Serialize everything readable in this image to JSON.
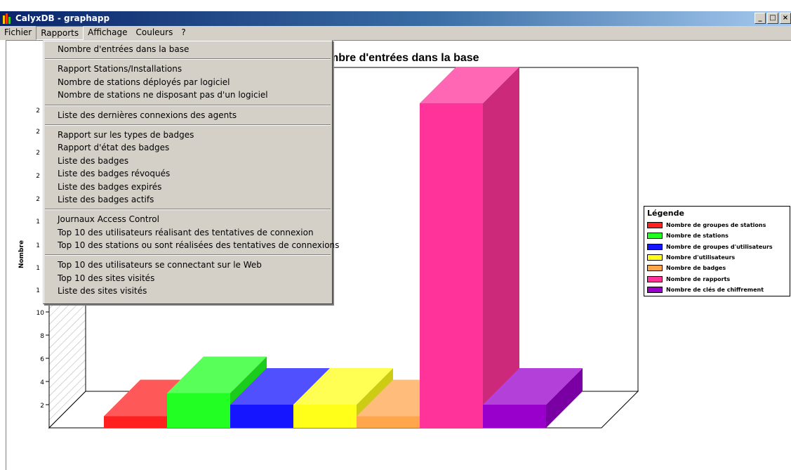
{
  "window": {
    "title": "CalyxDB - graphapp",
    "controls": [
      "_",
      "□",
      "×"
    ]
  },
  "menubar": {
    "items": [
      "Fichier",
      "Rapports",
      "Affichage",
      "Couleurs",
      "?"
    ],
    "active": "Rapports"
  },
  "dropdown": {
    "groups": [
      [
        "Nombre d'entrées dans la base"
      ],
      [
        "Rapport Stations/Installations",
        "Nombre de stations déployés par logiciel",
        "Nombre de stations ne disposant pas d'un logiciel"
      ],
      [
        "Liste des dernières connexions des agents"
      ],
      [
        "Rapport sur les types de badges",
        "Rapport d'état des badges",
        "Liste des badges",
        "Liste des badges révoqués",
        "Liste des badges expirés",
        "Liste des badges actifs"
      ],
      [
        "Journaux Access Control",
        "Top 10 des utilisateurs réalisant des tentatives de connexion",
        "Top 10 des stations ou sont réalisées des tentatives de connexions"
      ],
      [
        "Top 10 des utilisateurs se connectant sur le Web",
        "Top 10 des sites visités",
        "Liste des sites visités"
      ]
    ]
  },
  "chart_data": {
    "type": "bar",
    "title": "Nombre d'entrées dans la base",
    "ylabel": "Nombre",
    "visible_title_fragment": "mbre d'entrées dans la base",
    "y_ticks": [
      2,
      4,
      6,
      8,
      10
    ],
    "ylim": [
      0,
      30
    ],
    "series": [
      {
        "name": "Nombre de groupes de stations",
        "value": 1,
        "color": "#ff2020"
      },
      {
        "name": "Nombre de stations",
        "value": 3,
        "color": "#22ff22"
      },
      {
        "name": "Nombre de groupes d'utilisateurs",
        "value": 2,
        "color": "#1515ff"
      },
      {
        "name": "Nombre d'utilisateurs",
        "value": 2,
        "color": "#ffff1a"
      },
      {
        "name": "Nombre de badges",
        "value": 1,
        "color": "#ffa64d"
      },
      {
        "name": "Nombre de rapports",
        "value": 28,
        "color": "#ff3399"
      },
      {
        "name": "Nombre de clés de chiffrement",
        "value": 2,
        "color": "#9900cc"
      }
    ],
    "legend": {
      "title": "Légende",
      "placement": "right"
    }
  }
}
